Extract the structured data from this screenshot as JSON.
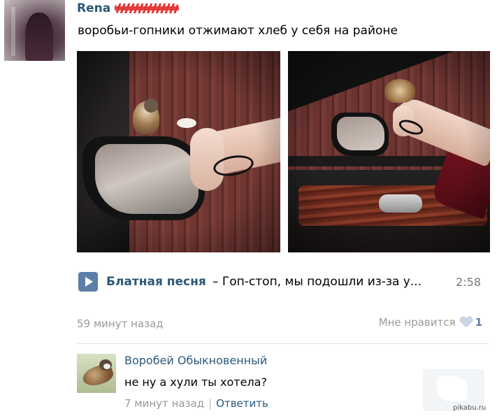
{
  "post": {
    "author": "Rena",
    "text": "воробьи-гопники отжимают хлеб у себя на районе",
    "time": "59 минут назад",
    "like_label": "Мне нравится",
    "like_count": "1"
  },
  "audio": {
    "artist": "Блатная песня",
    "title": "– Гоп-стоп, мы подошли из-за у...",
    "duration": "2:58"
  },
  "comment": {
    "author": "Воробей Обыкновенный",
    "text": "не ну а хули ты хотела?",
    "time": "7 минут назад",
    "separator": "|",
    "reply_label": "Ответить"
  },
  "watermark": {
    "text": "pikabu.ru"
  },
  "colors": {
    "link": "#2b587a",
    "muted": "#999999",
    "play_button": "#5b7fa6",
    "divider": "#e3e7ec"
  },
  "icons": [
    "play-icon",
    "heart-icon"
  ]
}
